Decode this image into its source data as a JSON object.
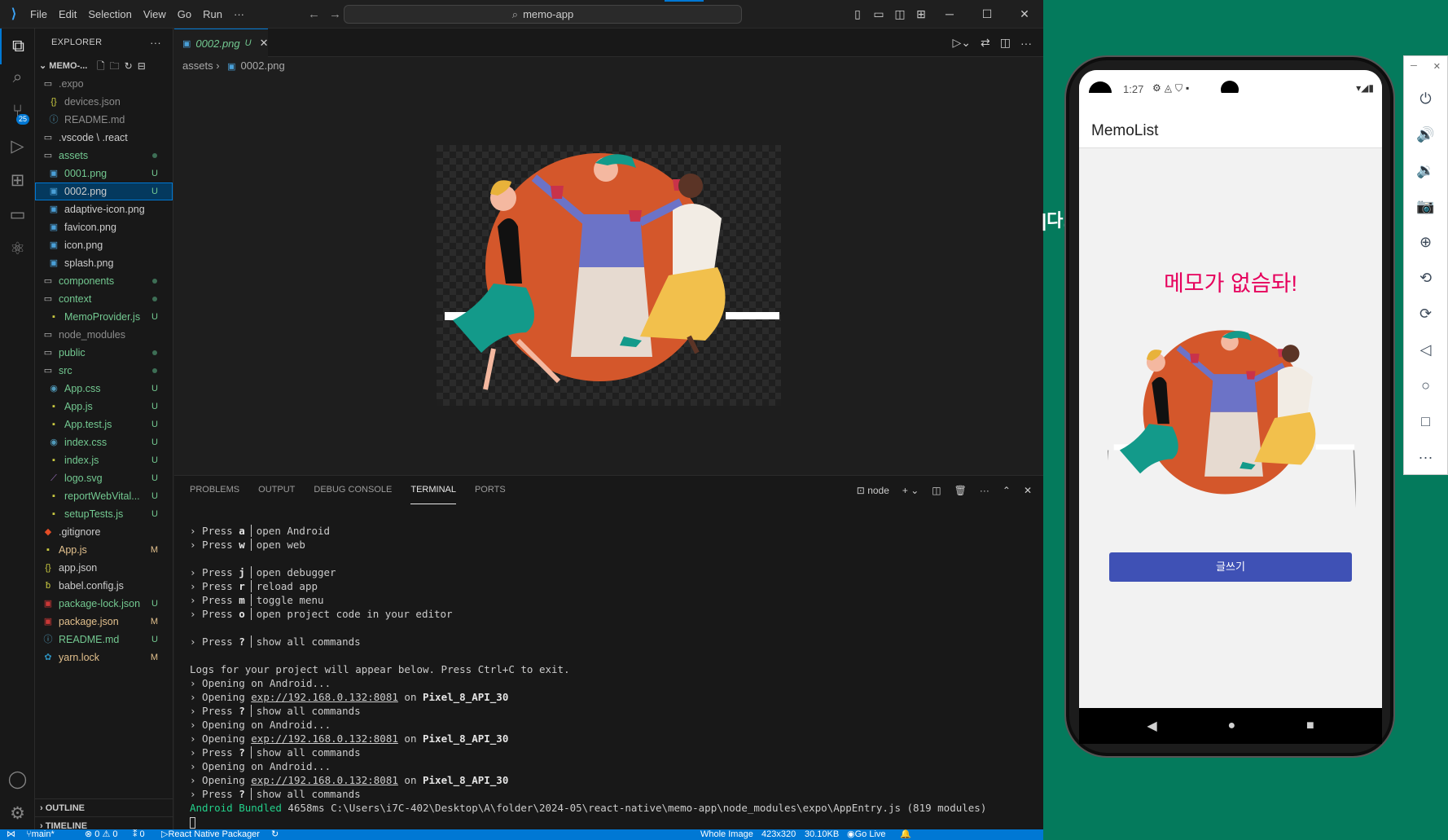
{
  "titlebar": {
    "menu": [
      "File",
      "Edit",
      "Selection",
      "View",
      "Go",
      "Run",
      "···"
    ],
    "search": "memo-app"
  },
  "activity": {
    "scm_badge": "25"
  },
  "explorer": {
    "header": "EXPLORER",
    "project": "MEMO-...",
    "tree": [
      {
        "name": ".expo",
        "indent": 1,
        "icon": "folder",
        "color": "gray",
        "status": ""
      },
      {
        "name": "devices.json",
        "indent": 2,
        "icon": "json",
        "color": "gray",
        "status": ""
      },
      {
        "name": "README.md",
        "indent": 2,
        "icon": "info",
        "color": "gray",
        "status": ""
      },
      {
        "name": ".vscode \\ .react",
        "indent": 1,
        "icon": "folder",
        "color": "white",
        "status": ""
      },
      {
        "name": "assets",
        "indent": 1,
        "icon": "folder",
        "color": "green",
        "status": "dot"
      },
      {
        "name": "0001.png",
        "indent": 2,
        "icon": "image",
        "color": "green",
        "status": "U"
      },
      {
        "name": "0002.png",
        "indent": 2,
        "icon": "image",
        "color": "white",
        "status": "U",
        "selected": true
      },
      {
        "name": "adaptive-icon.png",
        "indent": 2,
        "icon": "image",
        "color": "white",
        "status": ""
      },
      {
        "name": "favicon.png",
        "indent": 2,
        "icon": "image",
        "color": "white",
        "status": ""
      },
      {
        "name": "icon.png",
        "indent": 2,
        "icon": "image",
        "color": "white",
        "status": ""
      },
      {
        "name": "splash.png",
        "indent": 2,
        "icon": "image",
        "color": "white",
        "status": ""
      },
      {
        "name": "components",
        "indent": 1,
        "icon": "folder",
        "color": "green",
        "status": "dot"
      },
      {
        "name": "context",
        "indent": 1,
        "icon": "folder",
        "color": "green",
        "status": "dot"
      },
      {
        "name": "MemoProvider.js",
        "indent": 2,
        "icon": "js",
        "color": "green",
        "status": "U"
      },
      {
        "name": "node_modules",
        "indent": 1,
        "icon": "folder",
        "color": "gray",
        "status": ""
      },
      {
        "name": "public",
        "indent": 1,
        "icon": "folder",
        "color": "green",
        "status": "dot"
      },
      {
        "name": "src",
        "indent": 1,
        "icon": "folder",
        "color": "green",
        "status": "dot"
      },
      {
        "name": "App.css",
        "indent": 2,
        "icon": "css",
        "color": "green",
        "status": "U"
      },
      {
        "name": "App.js",
        "indent": 2,
        "icon": "js",
        "color": "green",
        "status": "U"
      },
      {
        "name": "App.test.js",
        "indent": 2,
        "icon": "js",
        "color": "green",
        "status": "U"
      },
      {
        "name": "index.css",
        "indent": 2,
        "icon": "css",
        "color": "green",
        "status": "U"
      },
      {
        "name": "index.js",
        "indent": 2,
        "icon": "js",
        "color": "green",
        "status": "U"
      },
      {
        "name": "logo.svg",
        "indent": 2,
        "icon": "svg",
        "color": "green",
        "status": "U"
      },
      {
        "name": "reportWebVital...",
        "indent": 2,
        "icon": "js",
        "color": "green",
        "status": "U"
      },
      {
        "name": "setupTests.js",
        "indent": 2,
        "icon": "js",
        "color": "green",
        "status": "U"
      },
      {
        "name": ".gitignore",
        "indent": 1,
        "icon": "git",
        "color": "white",
        "status": ""
      },
      {
        "name": "App.js",
        "indent": 1,
        "icon": "js",
        "color": "amber",
        "status": "M"
      },
      {
        "name": "app.json",
        "indent": 1,
        "icon": "json",
        "color": "white",
        "status": ""
      },
      {
        "name": "babel.config.js",
        "indent": 1,
        "icon": "babel",
        "color": "white",
        "status": ""
      },
      {
        "name": "package-lock.json",
        "indent": 1,
        "icon": "npm",
        "color": "green",
        "status": "U"
      },
      {
        "name": "package.json",
        "indent": 1,
        "icon": "npm",
        "color": "amber",
        "status": "M"
      },
      {
        "name": "README.md",
        "indent": 1,
        "icon": "info",
        "color": "green",
        "status": "U"
      },
      {
        "name": "yarn.lock",
        "indent": 1,
        "icon": "yarn",
        "color": "amber",
        "status": "M"
      }
    ],
    "outline": "OUTLINE",
    "timeline": "TIMELINE"
  },
  "editor": {
    "tab_name": "0002.png",
    "tab_status": "U",
    "breadcrumb_folder": "assets",
    "breadcrumb_file": "0002.png"
  },
  "panel": {
    "tabs": [
      "PROBLEMS",
      "OUTPUT",
      "DEBUG CONSOLE",
      "TERMINAL",
      "PORTS"
    ],
    "active_tab": "TERMINAL",
    "shell": "node"
  },
  "terminal": [
    {
      "type": "key",
      "key": "a",
      "desc": "open Android"
    },
    {
      "type": "key",
      "key": "w",
      "desc": "open web"
    },
    {
      "type": "blank"
    },
    {
      "type": "key",
      "key": "j",
      "desc": "open debugger"
    },
    {
      "type": "key",
      "key": "r",
      "desc": "reload app"
    },
    {
      "type": "key",
      "key": "m",
      "desc": "toggle menu"
    },
    {
      "type": "key",
      "key": "o",
      "desc": "open project code in your editor"
    },
    {
      "type": "blank"
    },
    {
      "type": "key",
      "key": "?",
      "desc": "show all commands"
    },
    {
      "type": "blank"
    },
    {
      "type": "text",
      "text": "Logs for your project will appear below. Press Ctrl+C to exit."
    },
    {
      "type": "text",
      "text": "› Opening on Android..."
    },
    {
      "type": "open",
      "url": "exp://192.168.0.132:8081",
      "device": "Pixel_8_API_30"
    },
    {
      "type": "key",
      "key": "?",
      "desc": "show all commands"
    },
    {
      "type": "text",
      "text": "› Opening on Android..."
    },
    {
      "type": "open",
      "url": "exp://192.168.0.132:8081",
      "device": "Pixel_8_API_30"
    },
    {
      "type": "key",
      "key": "?",
      "desc": "show all commands"
    },
    {
      "type": "text",
      "text": "› Opening on Android..."
    },
    {
      "type": "open",
      "url": "exp://192.168.0.132:8081",
      "device": "Pixel_8_API_30"
    },
    {
      "type": "key",
      "key": "?",
      "desc": "show all commands"
    },
    {
      "type": "bundled",
      "a": "Android",
      "b": "Bundled",
      "rest": " 4658ms C:\\Users\\i7C-402\\Desktop\\A\\folder\\2024-05\\react-native\\memo-app\\node_modules\\expo\\AppEntry.js (819 modules)"
    },
    {
      "type": "cursor"
    }
  ],
  "statusbar": {
    "branch": "main*",
    "problems": "⊗ 0 ⚠ 0",
    "ports": "⁑ 0",
    "task": "React Native Packager",
    "whole_image": "Whole Image",
    "dims": "423x320",
    "size": "30.10KB",
    "golive": "Go Live"
  },
  "phone": {
    "time": "1:27",
    "app_title": "MemoList",
    "empty_message": "메모가 없슴돠!",
    "write_button": "글쓰기"
  },
  "snippet_text": "|다."
}
